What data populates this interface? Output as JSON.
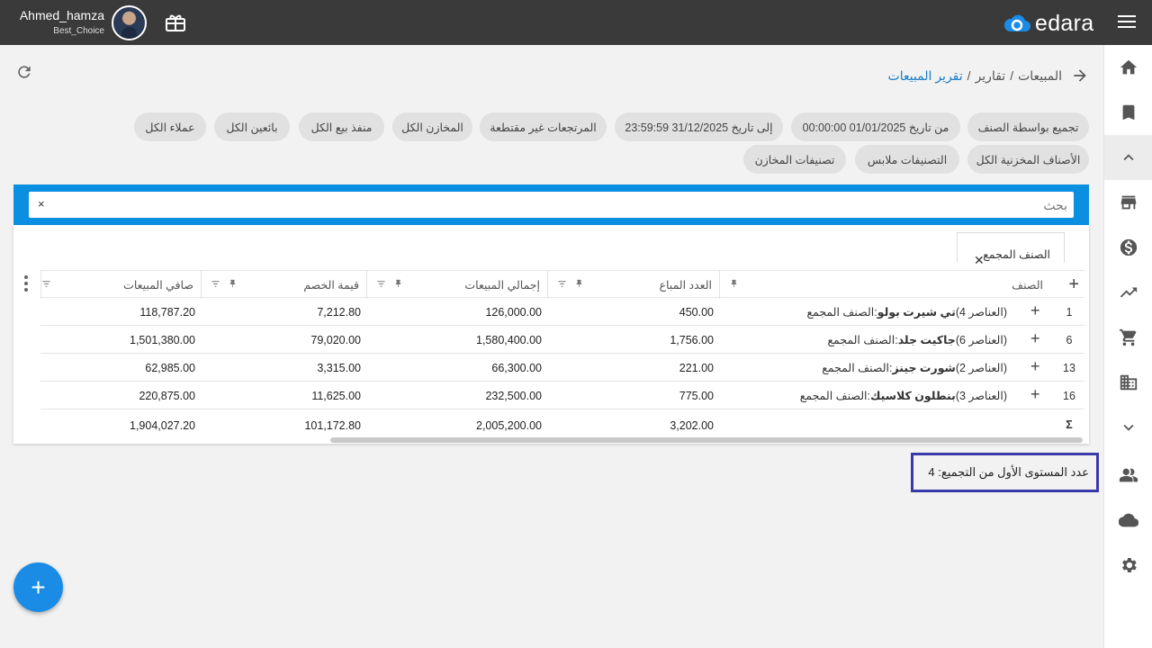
{
  "user": {
    "name": "Ahmed_hamza",
    "company": "Best_Choice"
  },
  "brand": {
    "name": "edara",
    "accent": "#1a8ce6"
  },
  "breadcrumb": {
    "root": "المبيعات",
    "section": "تقارير",
    "current": "تقرير المبيعات",
    "sep": "/"
  },
  "filters": {
    "group_by": "تجميع بواسطة  الصنف",
    "from_date": "من تاريخ  01/01/2025 00:00:00",
    "to_date": "إلى تاريخ  31/12/2025 23:59:59",
    "returns": "المرتجعات غير مقتطعة",
    "warehouses": "المخازن  الكل",
    "pos": "منفذ بيع  الكل",
    "sellers": "بائعين  الكل",
    "customers": "عملاء  الكل",
    "stock_items": "الأصناف المخزنية  الكل",
    "categories": "التصنيفات  ملابس",
    "warehouse_categories": "تصنيفات المخازن"
  },
  "search": {
    "placeholder": "بحث",
    "clear": "×"
  },
  "group_chip": {
    "label": "الصنف المجمع",
    "remove": "✕"
  },
  "grid": {
    "columns": {
      "item": "الصنف",
      "qty": "العدد المباع",
      "total": "إجمالي المبيعات",
      "discount": "قيمة الخصم",
      "net": "صافي المبيعات"
    },
    "rows": [
      {
        "num": "1",
        "count": "(العناصر 4)",
        "name": "تي شيرت بولو",
        "suffix": ":الصنف المجمع",
        "qty": "450.00",
        "total": "126,000.00",
        "discount": "7,212.80",
        "net": "118,787.20"
      },
      {
        "num": "6",
        "count": "(العناصر 6)",
        "name": "جاكيت جلد",
        "suffix": ":الصنف المجمع",
        "qty": "1,756.00",
        "total": "1,580,400.00",
        "discount": "79,020.00",
        "net": "1,501,380.00"
      },
      {
        "num": "13",
        "count": "(العناصر 2)",
        "name": "شورت جينز",
        "suffix": ":الصنف المجمع",
        "qty": "221.00",
        "total": "66,300.00",
        "discount": "3,315.00",
        "net": "62,985.00"
      },
      {
        "num": "16",
        "count": "(العناصر 3)",
        "name": "بنطلون كلاسيك",
        "suffix": ":الصنف المجمع",
        "qty": "775.00",
        "total": "232,500.00",
        "discount": "11,625.00",
        "net": "220,875.00"
      }
    ],
    "totals": {
      "sigma": "Σ",
      "qty": "3,202.00",
      "total": "2,005,200.00",
      "discount": "101,172.80",
      "net": "1,904,027.20"
    }
  },
  "group_count": "عدد المستوى الأول من التجميع: 4",
  "fab": "+"
}
